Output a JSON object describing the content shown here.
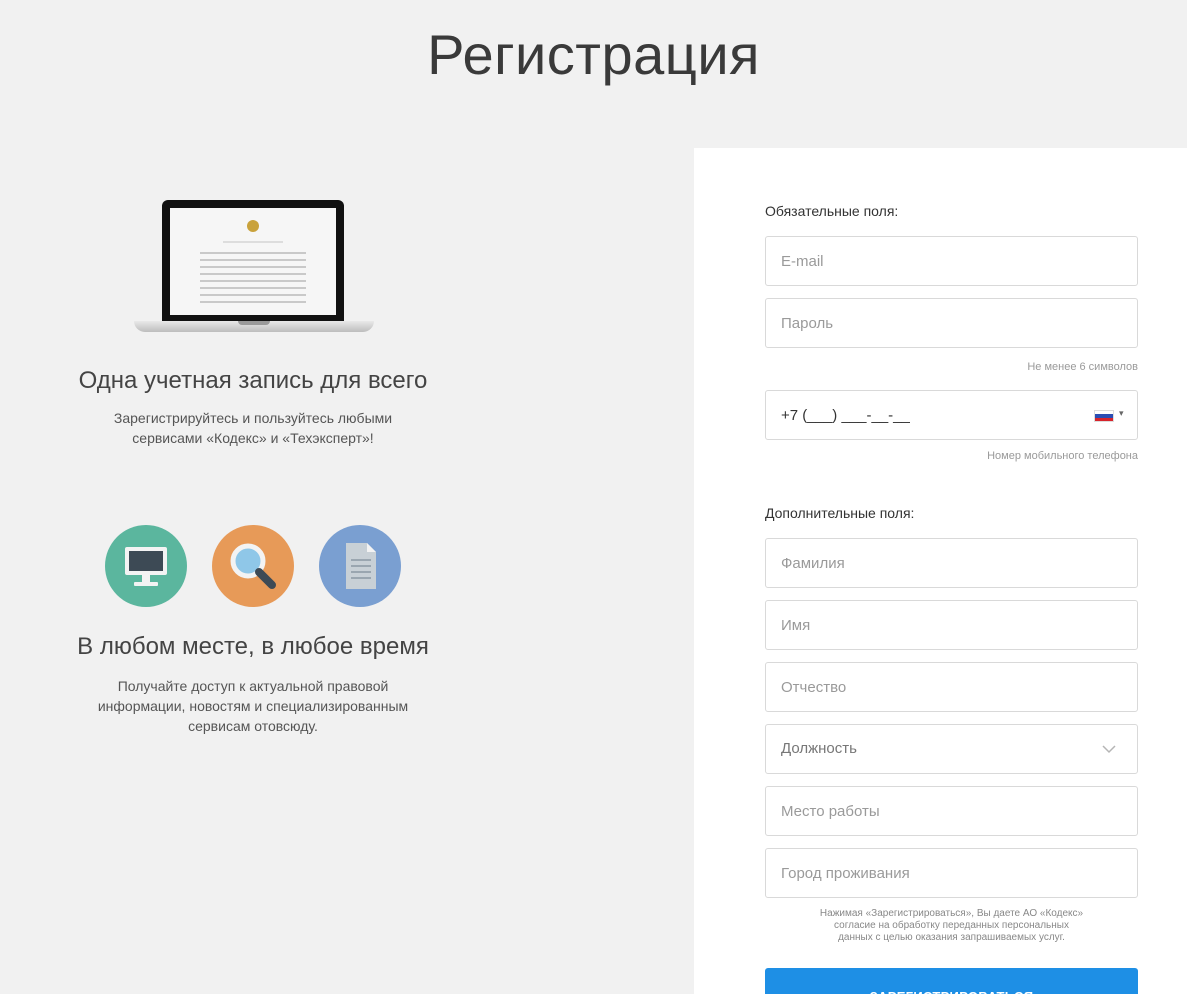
{
  "page": {
    "title": "Регистрация"
  },
  "promo": {
    "block1": {
      "heading": "Одна учетная запись для всего",
      "line1": "Зарегистрируйтесь и пользуйтесь любыми",
      "line2": "сервисами «Кодекс» и «Техэксперт»!"
    },
    "block2": {
      "heading": "В любом месте, в любое время",
      "line1": "Получайте доступ к актуальной правовой",
      "line2": "информации, новостям и специализированным",
      "line3": "сервисам отовсюду."
    },
    "icons": [
      {
        "name": "monitor-icon",
        "color": "#5bb69e"
      },
      {
        "name": "search-icon",
        "color": "#e79a58"
      },
      {
        "name": "document-icon",
        "color": "#7a9fd1"
      }
    ]
  },
  "form": {
    "required_label": "Обязательные поля:",
    "email_placeholder": "E-mail",
    "password_placeholder": "Пароль",
    "password_hint": "Не менее 6 символов",
    "phone_value": "+7 (___) ___-__-__",
    "phone_hint": "Номер мобильного телефона",
    "optional_label": "Дополнительные поля:",
    "lastname_placeholder": "Фамилия",
    "firstname_placeholder": "Имя",
    "middlename_placeholder": "Отчество",
    "position_value": "Должность",
    "workplace_placeholder": "Место работы",
    "city_placeholder": "Город проживания",
    "consent_line1": "Нажимая «Зарегистрироваться», Вы даете АО «Кодекс»",
    "consent_line2": "согласие на обработку переданных персональных",
    "consent_line3": "данных с целью оказания запрашиваемых услуг.",
    "submit_label": "ЗАРЕГИСТРИРОВАТЬСЯ",
    "accent_color": "#1e8fe5"
  }
}
